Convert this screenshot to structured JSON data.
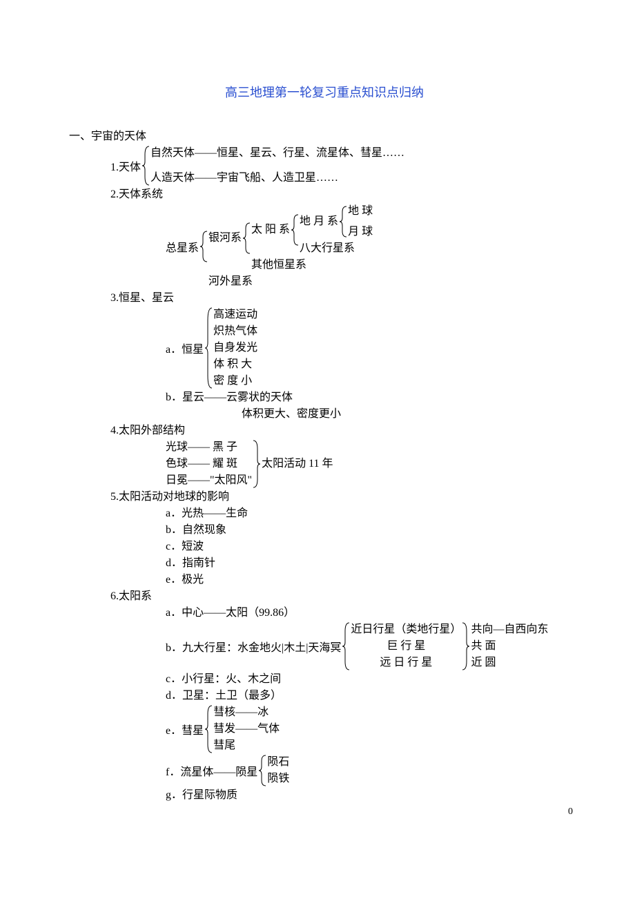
{
  "title": "高三地理第一轮复习重点知识点归纳",
  "s1": {
    "h": "一、宇宙的天体",
    "p1": {
      "label": "1.天体",
      "items": [
        "自然天体——恒星、星云、行星、流星体、彗星……",
        "人造天体——宇宙飞船、人造卫星……"
      ]
    },
    "p2": {
      "h": "2.天体系统",
      "root": "总星系",
      "lvl1": [
        "银河系",
        "河外星系"
      ],
      "lvl2_label": "太 阳 系",
      "lvl2_other": "其他恒星系",
      "lvl3": [
        "地 月 系",
        "八大行星系"
      ],
      "lvl4": [
        "地 球",
        "月 球"
      ]
    },
    "p3": {
      "h": "3.恒星、星云",
      "a_label": "a．恒星",
      "a_items": [
        "高速运动",
        "炽热气体",
        "自身发光",
        "体 积 大",
        "密 度 小"
      ],
      "b1": "b．星云——云雾状的天体",
      "b2": "体积更大、密度更小"
    },
    "p4": {
      "h": "4.太阳外部结构",
      "items": [
        "光球—— 黑 子",
        "色球—— 耀 斑",
        "日冕——\"太阳风\""
      ],
      "right": "太阳活动  11 年"
    },
    "p5": {
      "h": "5.太阳活动对地球的影响",
      "items": [
        "a．光热——生命",
        "b．自然现象",
        "c．短波",
        "d．指南针",
        "e．极光"
      ]
    },
    "p6": {
      "h": "6.太阳系",
      "a": "a．中心——太阳（99.86）",
      "b_label": "b．九大行星：水金地火|木土|天海冥",
      "b_items": [
        "近日行星（类地行星）",
        "巨  行  星",
        "远 日 行 星"
      ],
      "b_right": [
        "共向—自西向东",
        "共 面",
        "近 圆"
      ],
      "c": "c．小行星：火、木之间",
      "d": "d．卫星：土卫（最多）",
      "e_label": "e．彗星",
      "e_items": [
        "彗核——冰",
        "彗发——气体",
        "彗尾"
      ],
      "f_label": "f．流星体——陨星",
      "f_items": [
        "陨石",
        "陨铁"
      ],
      "g": "g．行星际物质"
    }
  },
  "pagenum": "0"
}
